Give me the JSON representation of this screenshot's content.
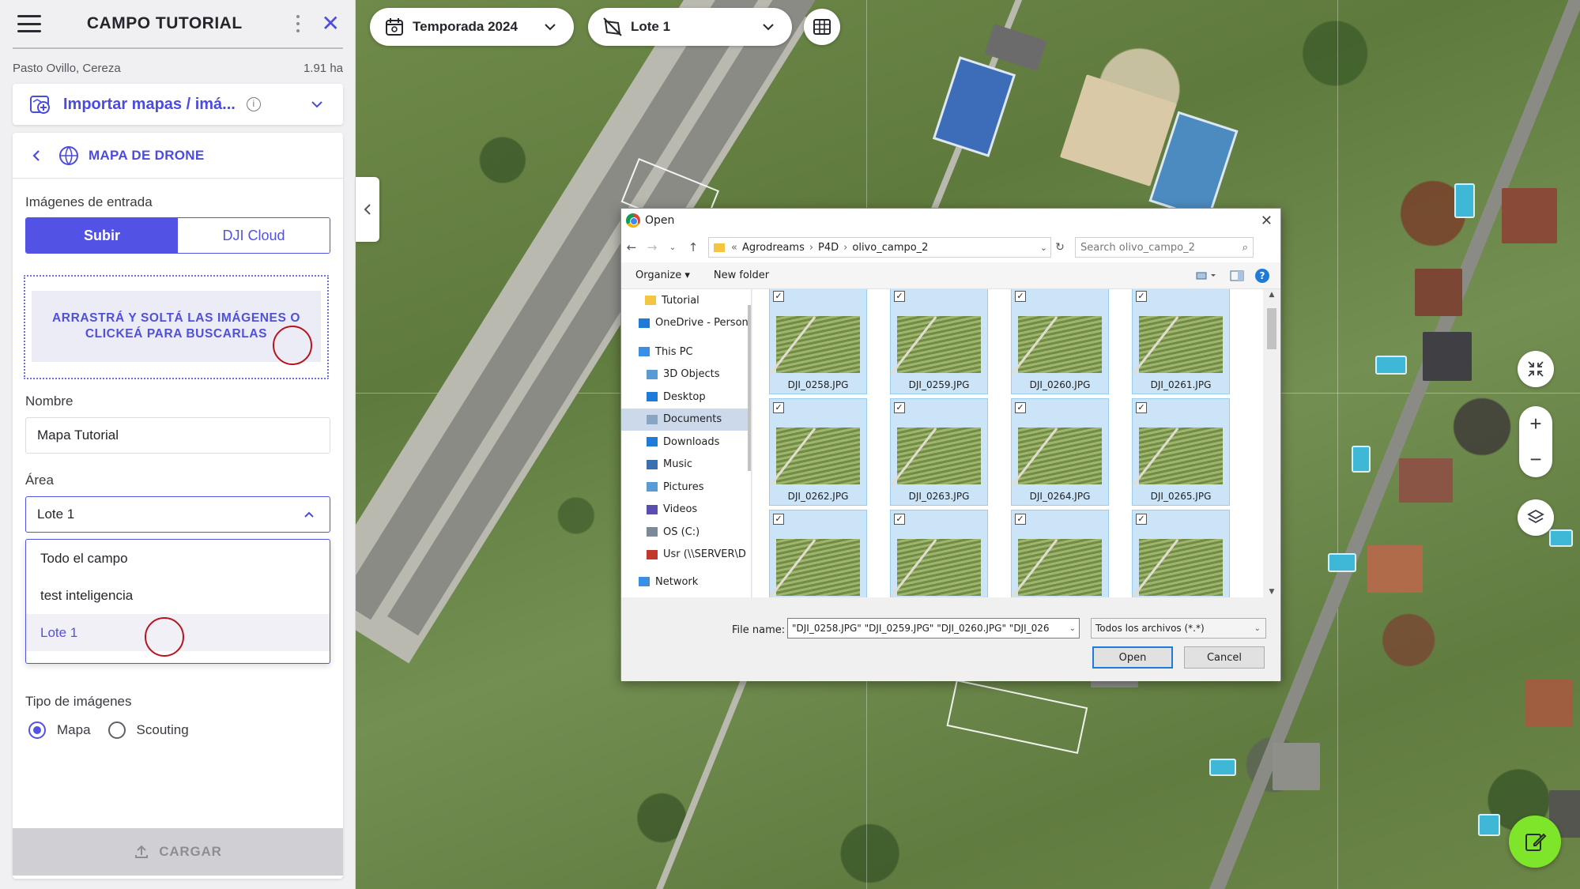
{
  "panel": {
    "title": "CAMPO TUTORIAL",
    "farm_name": "Pasto Ovillo, Cereza",
    "farm_area": "1.91 ha",
    "import_label": "Importar mapas / imá...",
    "section_title": "MAPA DE DRONE",
    "input_images_label": "Imágenes de entrada",
    "tabs": [
      "Subir",
      "DJI Cloud"
    ],
    "dropzone_text": "ARRASTRÁ Y SOLTÁ LAS IMÁGENES O CLICKEÁ PARA BUSCARLAS",
    "name_label": "Nombre",
    "name_value": "Mapa Tutorial",
    "area_label": "Área",
    "area_value": "Lote 1",
    "area_options": [
      "Todo el campo",
      "test inteligencia",
      "Lote 1"
    ],
    "image_type_label": "Tipo de imágenes",
    "image_types": [
      "Mapa",
      "Scouting"
    ],
    "image_type_selected": "Mapa",
    "upload_button": "CARGAR"
  },
  "topbar": {
    "season": "Temporada 2024",
    "lot": "Lote 1"
  },
  "dialog": {
    "title": "Open",
    "path": [
      "Agrodreams",
      "P4D",
      "olivo_campo_2"
    ],
    "search_placeholder": "Search olivo_campo_2",
    "organize": "Organize ▾",
    "new_folder": "New folder",
    "nav_items": [
      {
        "label": "Tutorial",
        "icon": "folder-icon"
      },
      {
        "label": "OneDrive - Person",
        "icon": "cloud-icon"
      },
      {
        "label": "This PC",
        "icon": "computer-icon"
      },
      {
        "label": "3D Objects",
        "icon": "cube-icon"
      },
      {
        "label": "Desktop",
        "icon": "desktop-icon"
      },
      {
        "label": "Documents",
        "icon": "document-icon"
      },
      {
        "label": "Downloads",
        "icon": "download-icon"
      },
      {
        "label": "Music",
        "icon": "music-icon"
      },
      {
        "label": "Pictures",
        "icon": "picture-icon"
      },
      {
        "label": "Videos",
        "icon": "video-icon"
      },
      {
        "label": "OS (C:)",
        "icon": "drive-icon"
      },
      {
        "label": "Usr (\\\\SERVER\\D",
        "icon": "network-drive-icon"
      },
      {
        "label": "Network",
        "icon": "network-icon"
      }
    ],
    "selected_nav": "Documents",
    "files": [
      "DJI_0258.JPG",
      "DJI_0259.JPG",
      "DJI_0260.JPG",
      "DJI_0261.JPG",
      "DJI_0262.JPG",
      "DJI_0263.JPG",
      "DJI_0264.JPG",
      "DJI_0265.JPG",
      "",
      "",
      "",
      ""
    ],
    "file_name_label": "File name:",
    "file_name_value": "\"DJI_0258.JPG\" \"DJI_0259.JPG\" \"DJI_0260.JPG\" \"DJI_026",
    "file_type": "Todos los archivos (*.*)",
    "open_button": "Open",
    "cancel_button": "Cancel"
  },
  "colors": {
    "accent": "#5252e4",
    "fab": "#7ee52a",
    "click_marker": "#b5151f"
  }
}
